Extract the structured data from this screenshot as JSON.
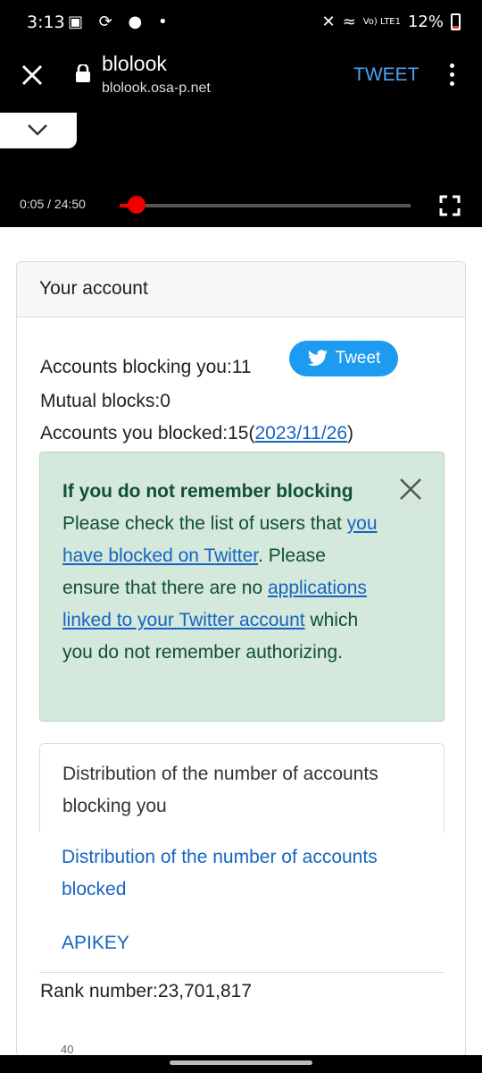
{
  "status": {
    "time": "3:13",
    "battery": "12%",
    "signal_label": "Vo) LTE1"
  },
  "browser": {
    "site_title": "blolook",
    "site_url": "blolook.osa-p.net",
    "tweet_label": "TWEET"
  },
  "video": {
    "time_display": "0:05 / 24:50",
    "progress_fraction": 0.003
  },
  "card": {
    "header": "Your account",
    "blocking_you": "Accounts blocking you:11",
    "mutual_blocks": "Mutual blocks:0",
    "you_blocked_prefix": "Accounts you blocked:15(",
    "you_blocked_date": "2023/11/26",
    "you_blocked_suffix": ")",
    "tweet_button": "Tweet"
  },
  "alert": {
    "heading": "If you do not remember blocking",
    "line1": "Please check the list of users that ",
    "link1": "you have blocked on Twitter",
    "line2": ". Please ensure that there are no ",
    "link2": "applications linked to your Twitter account",
    "line3": " which you do not remember authorizing."
  },
  "list": {
    "item1": "Distribution of the number of accounts blocking you",
    "item2": "Distribution of the number of accounts blocked",
    "item3": "APIKEY"
  },
  "rank": "Rank number:23,701,817",
  "cut_axis_label": "40"
}
